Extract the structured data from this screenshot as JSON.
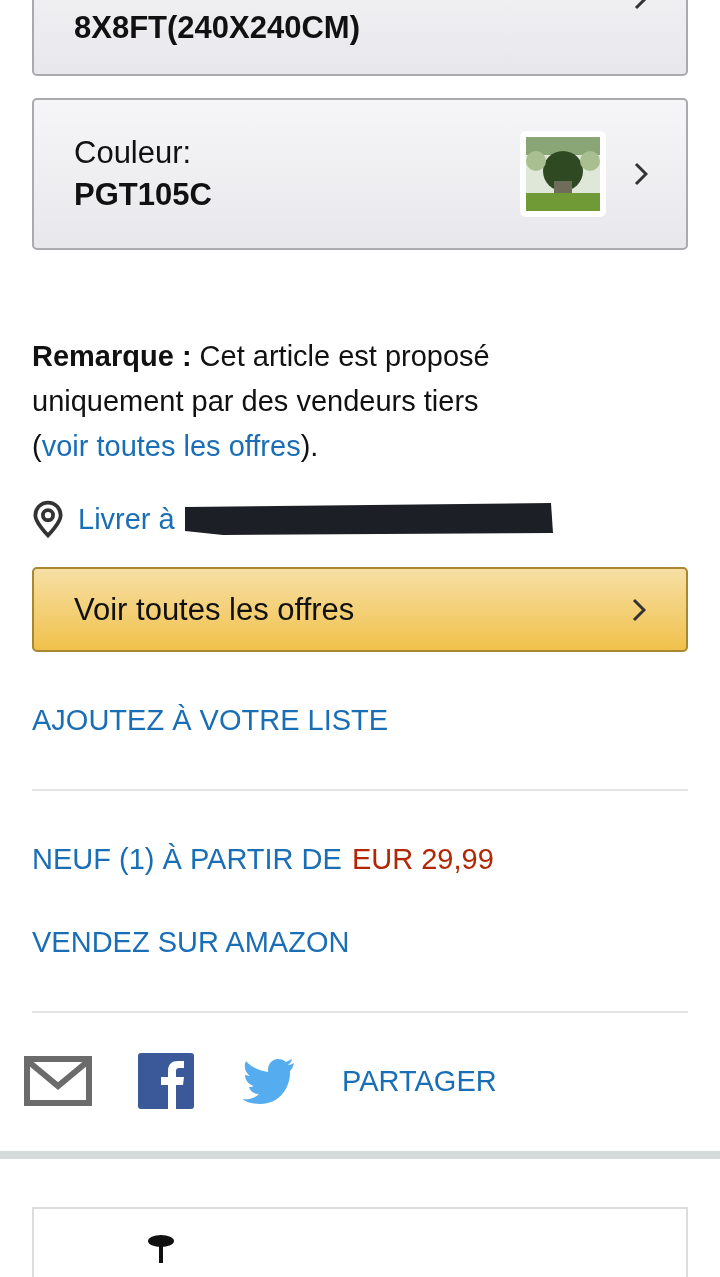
{
  "size_selector": {
    "value": "8X8FT(240X240CM)"
  },
  "color_selector": {
    "label": "Couleur:",
    "value": "PGT105C"
  },
  "note": {
    "text": "**Remarque :** Cet article est proposé uniquement par des vendeurs tiers (",
    "link": "voir toutes les offres",
    "after": ")."
  },
  "delivery": {
    "label": "Livrer à",
    "address_redacted": true
  },
  "offers_button": {
    "label": "Voir toutes les offres"
  },
  "add_to_list": {
    "label": "AJOUTEZ À VOTRE LISTE"
  },
  "new_offers": {
    "label": "NEUF (1) À PARTIR DE",
    "price": "EUR 29,99"
  },
  "sell_link": {
    "label": "VENDEZ SUR AMAZON"
  },
  "share": {
    "label": "PARTAGER"
  }
}
